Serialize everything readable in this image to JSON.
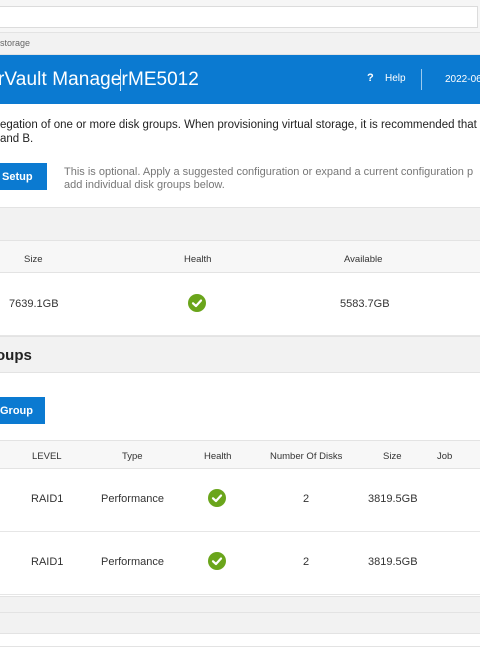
{
  "breadcrumb": "storage",
  "header": {
    "app_name": "rVault Manager",
    "model": "ME5012",
    "help_icon": "?",
    "help_label": "Help",
    "datetime": "2022-06"
  },
  "intro_text": {
    "line1": "egation of one or more disk groups. When provisioning virtual storage, it is recommended that disk",
    "line2": "and B."
  },
  "setup": {
    "button_label": "Setup",
    "note_line1": "This is optional. Apply a suggested configuration or expand a current configuration p",
    "note_line2": "add individual disk groups below."
  },
  "pool_table": {
    "columns": [
      "Size",
      "Health",
      "Available"
    ],
    "rows": [
      {
        "size": "7639.1GB",
        "health": "ok",
        "available": "5583.7GB"
      }
    ]
  },
  "disk_groups": {
    "title": "oups",
    "add_button_label": "Group",
    "columns": [
      "LEVEL",
      "Type",
      "Health",
      "Number Of Disks",
      "Size",
      "Job"
    ],
    "rows": [
      {
        "level": "RAID1",
        "type": "Performance",
        "health": "ok",
        "disks": "2",
        "size": "3819.5GB",
        "job": ""
      },
      {
        "level": "RAID1",
        "type": "Performance",
        "health": "ok",
        "disks": "2",
        "size": "3819.5GB",
        "job": ""
      }
    ]
  },
  "colors": {
    "accent": "#0b7ad1",
    "health_ok": "#6aa51b"
  },
  "icons": {
    "health": "check-circle-icon",
    "help": "question-icon"
  }
}
